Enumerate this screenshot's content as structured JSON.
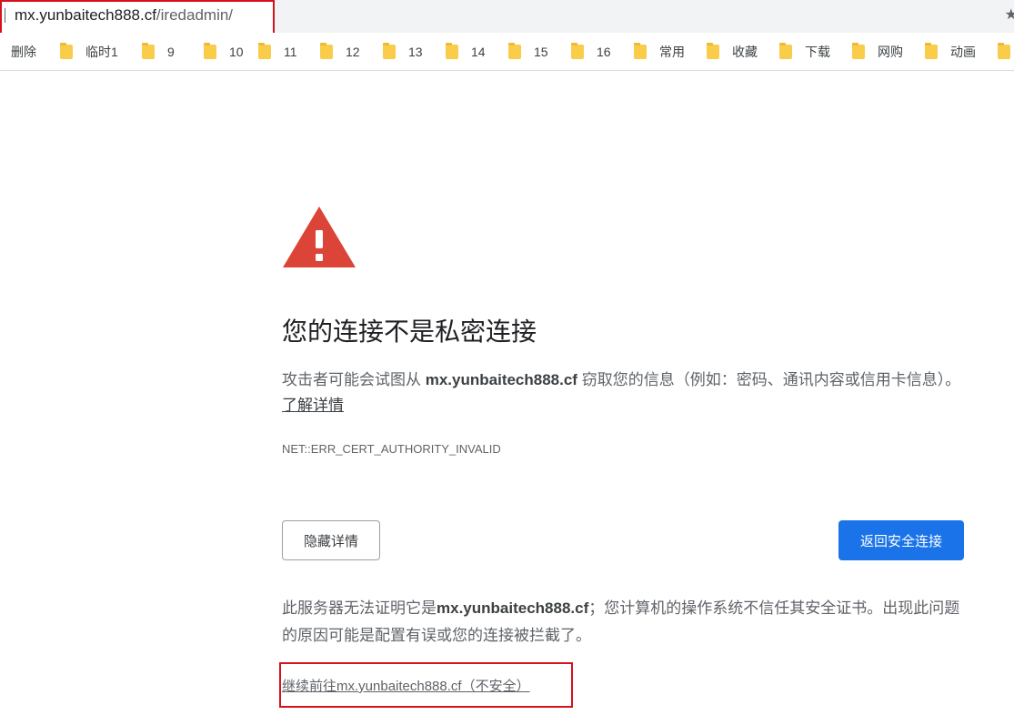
{
  "address_bar": {
    "host": "mx.yunbaitech888.cf",
    "path": "/iredadmin/"
  },
  "bookmarks": [
    {
      "label": "删除",
      "folder": false
    },
    {
      "label": "临时1",
      "folder": true
    },
    {
      "label": "9",
      "folder": true
    },
    {
      "label": "10",
      "folder": true
    },
    {
      "label": "11",
      "folder": true
    },
    {
      "label": "12",
      "folder": true
    },
    {
      "label": "13",
      "folder": true
    },
    {
      "label": "14",
      "folder": true
    },
    {
      "label": "15",
      "folder": true
    },
    {
      "label": "16",
      "folder": true
    },
    {
      "label": "常用",
      "folder": true
    },
    {
      "label": "收藏",
      "folder": true
    },
    {
      "label": "下载",
      "folder": true
    },
    {
      "label": "网购",
      "folder": true
    },
    {
      "label": "动画",
      "folder": true
    }
  ],
  "interstitial": {
    "heading": "您的连接不是私密连接",
    "explanation": {
      "prefix": "攻击者可能会试图从 ",
      "host": "mx.yunbaitech888.cf",
      "suffix": " 窃取您的信息（例如：密码、通讯内容或信用卡信息）。",
      "learn_more": "了解详情"
    },
    "error_code": "NET::ERR_CERT_AUTHORITY_INVALID",
    "hide_details_button": "隐藏详情",
    "back_to_safety_button": "返回安全连接",
    "details": {
      "prefix": "此服务器无法证明它是",
      "host": "mx.yunbaitech888.cf",
      "suffix": "；您计算机的操作系统不信任其安全证书。出现此问题的原因可能是配置有误或您的连接被拦截了。"
    },
    "proceed_link": "继续前往mx.yunbaitech888.cf（不安全）"
  },
  "colors": {
    "warning_red": "#db4437",
    "primary_blue": "#1a73e8",
    "highlight_box": "#d6121d"
  },
  "icons": {
    "warning": "warning-triangle-icon",
    "folder": "folder-icon",
    "bookmark_star": "star-icon"
  }
}
